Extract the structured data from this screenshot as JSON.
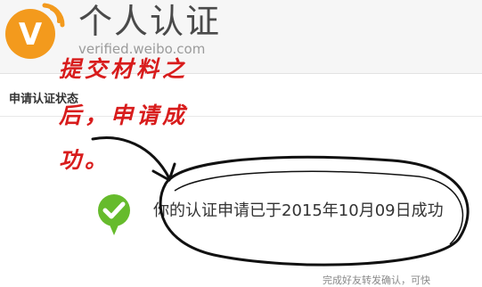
{
  "header": {
    "title": "个人认证",
    "subtitle": "verified.weibo.com",
    "logo_letter": "V"
  },
  "section": {
    "label": "申请认证状态"
  },
  "status": {
    "message": "你的认证申请已于2015年10月09日成功",
    "icon": "check-circle-icon"
  },
  "footer": {
    "text": "完成好友转发确认，可快"
  },
  "annotation": {
    "line1": "提交材料之",
    "line2": "后，申请成",
    "line3": "功。"
  },
  "colors": {
    "brand_orange": "#f39a1d",
    "success_green": "#66bb2c",
    "annotation_red": "#d81c1c"
  }
}
